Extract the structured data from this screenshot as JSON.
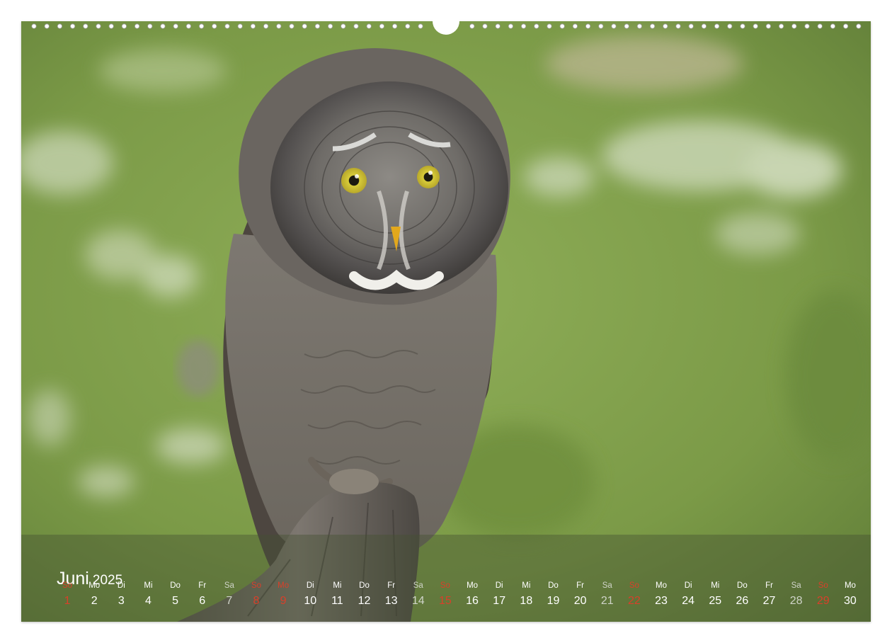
{
  "calendar": {
    "month": "Juni",
    "year": "2025",
    "days": [
      {
        "wd": "So",
        "d": "1",
        "type": "sun"
      },
      {
        "wd": "Mo",
        "d": "2",
        "type": "work"
      },
      {
        "wd": "Di",
        "d": "3",
        "type": "work"
      },
      {
        "wd": "Mi",
        "d": "4",
        "type": "work"
      },
      {
        "wd": "Do",
        "d": "5",
        "type": "work"
      },
      {
        "wd": "Fr",
        "d": "6",
        "type": "work"
      },
      {
        "wd": "Sa",
        "d": "7",
        "type": "sat"
      },
      {
        "wd": "So",
        "d": "8",
        "type": "sun"
      },
      {
        "wd": "Mo",
        "d": "9",
        "type": "sun"
      },
      {
        "wd": "Di",
        "d": "10",
        "type": "work"
      },
      {
        "wd": "Mi",
        "d": "11",
        "type": "work"
      },
      {
        "wd": "Do",
        "d": "12",
        "type": "work"
      },
      {
        "wd": "Fr",
        "d": "13",
        "type": "work"
      },
      {
        "wd": "Sa",
        "d": "14",
        "type": "sat"
      },
      {
        "wd": "So",
        "d": "15",
        "type": "sun"
      },
      {
        "wd": "Mo",
        "d": "16",
        "type": "work"
      },
      {
        "wd": "Di",
        "d": "17",
        "type": "work"
      },
      {
        "wd": "Mi",
        "d": "18",
        "type": "work"
      },
      {
        "wd": "Do",
        "d": "19",
        "type": "work"
      },
      {
        "wd": "Fr",
        "d": "20",
        "type": "work"
      },
      {
        "wd": "Sa",
        "d": "21",
        "type": "sat"
      },
      {
        "wd": "So",
        "d": "22",
        "type": "sun"
      },
      {
        "wd": "Mo",
        "d": "23",
        "type": "work"
      },
      {
        "wd": "Di",
        "d": "24",
        "type": "work"
      },
      {
        "wd": "Mi",
        "d": "25",
        "type": "work"
      },
      {
        "wd": "Do",
        "d": "26",
        "type": "work"
      },
      {
        "wd": "Fr",
        "d": "27",
        "type": "work"
      },
      {
        "wd": "Sa",
        "d": "28",
        "type": "sat"
      },
      {
        "wd": "So",
        "d": "29",
        "type": "sun"
      },
      {
        "wd": "Mo",
        "d": "30",
        "type": "work"
      }
    ]
  },
  "photo": {
    "subject": "great-grey-owl",
    "background_color": "#7f9a4e"
  }
}
